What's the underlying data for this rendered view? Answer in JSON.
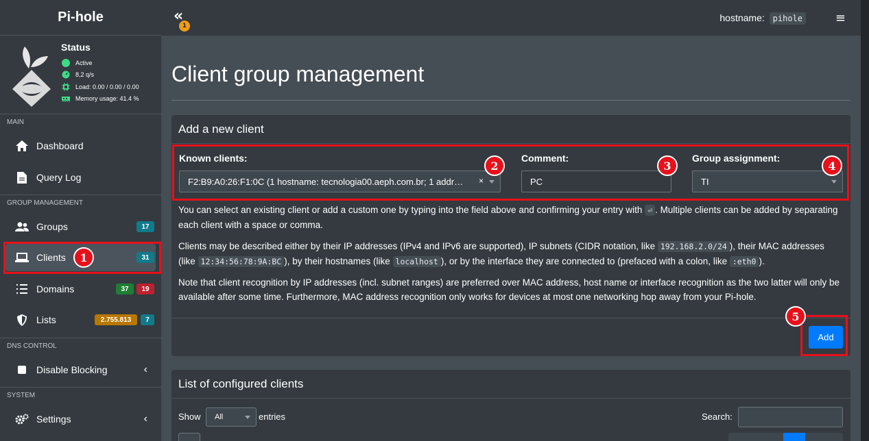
{
  "brand": "Pi-hole",
  "status": {
    "title": "Status",
    "active": "Active",
    "rate": "8,2 q/s",
    "load": "Load:  0.00 / 0.00 / 0.00",
    "memory": "Memory usage:  41.4 %"
  },
  "sections": {
    "main": "MAIN",
    "group": "GROUP MANAGEMENT",
    "dns": "DNS CONTROL",
    "system": "SYSTEM"
  },
  "nav": {
    "dashboard": "Dashboard",
    "querylog": "Query Log",
    "groups": "Groups",
    "groups_count": "17",
    "clients": "Clients",
    "clients_count": "31",
    "domains": "Domains",
    "domains_allow": "37",
    "domains_deny": "19",
    "lists": "Lists",
    "lists_domains": "2.755.813",
    "lists_count": "7",
    "disable": "Disable Blocking",
    "settings": "Settings"
  },
  "topbar": {
    "toggle": "«",
    "notifications": "1",
    "hostname_label": "hostname:",
    "hostname_value": "pihole",
    "menu": "≡"
  },
  "page_title": "Client group management",
  "add_card": {
    "title": "Add a new client",
    "known_label": "Known clients:",
    "known_value": "F2:B9:A0:26:F1:0C (1 hostname: tecnologia00.aeph.com.br; 1 addr…",
    "clear": "×",
    "comment_label": "Comment:",
    "comment_value": "PC",
    "group_label": "Group assignment:",
    "group_value": "TI",
    "help1a": "You can select an existing client or add a custom one by typing into the field above and confirming your entry with ",
    "help1_key": "⏎",
    "help1b": ". Multiple clients can be added by separating each client with a space or comma.",
    "help2a": "Clients may be described either by their IP addresses (IPv4 and IPv6 are supported), IP subnets (CIDR notation, like ",
    "help2_code1": "192.168.2.0/24",
    "help2b": "), their MAC addresses (like ",
    "help2_code2": "12:34:56:78:9A:BC",
    "help2c": "), by their hostnames (like ",
    "help2_code3": "localhost",
    "help2d": "), or by the interface they are connected to (prefaced with a colon, like ",
    "help2_code4": ":eth0",
    "help2e": ").",
    "help3": "Note that client recognition by IP addresses (incl. subnet ranges) are preferred over MAC address, host name or interface recognition as the two latter will only be available after some time. Furthermore, MAC address recognition only works for devices at most one networking hop away from your Pi-hole.",
    "add_button": "Add"
  },
  "list_card": {
    "title": "List of configured clients",
    "show": "Show",
    "entries_value": "All",
    "entries": "entries",
    "search": "Search:"
  },
  "markers": {
    "m1": "1",
    "m2": "2",
    "m3": "3",
    "m4": "4",
    "m5": "5"
  },
  "colors": {
    "highlight": "#e8101a",
    "primary": "#007bff",
    "sidebar": "#343a40",
    "content": "#454d55"
  }
}
